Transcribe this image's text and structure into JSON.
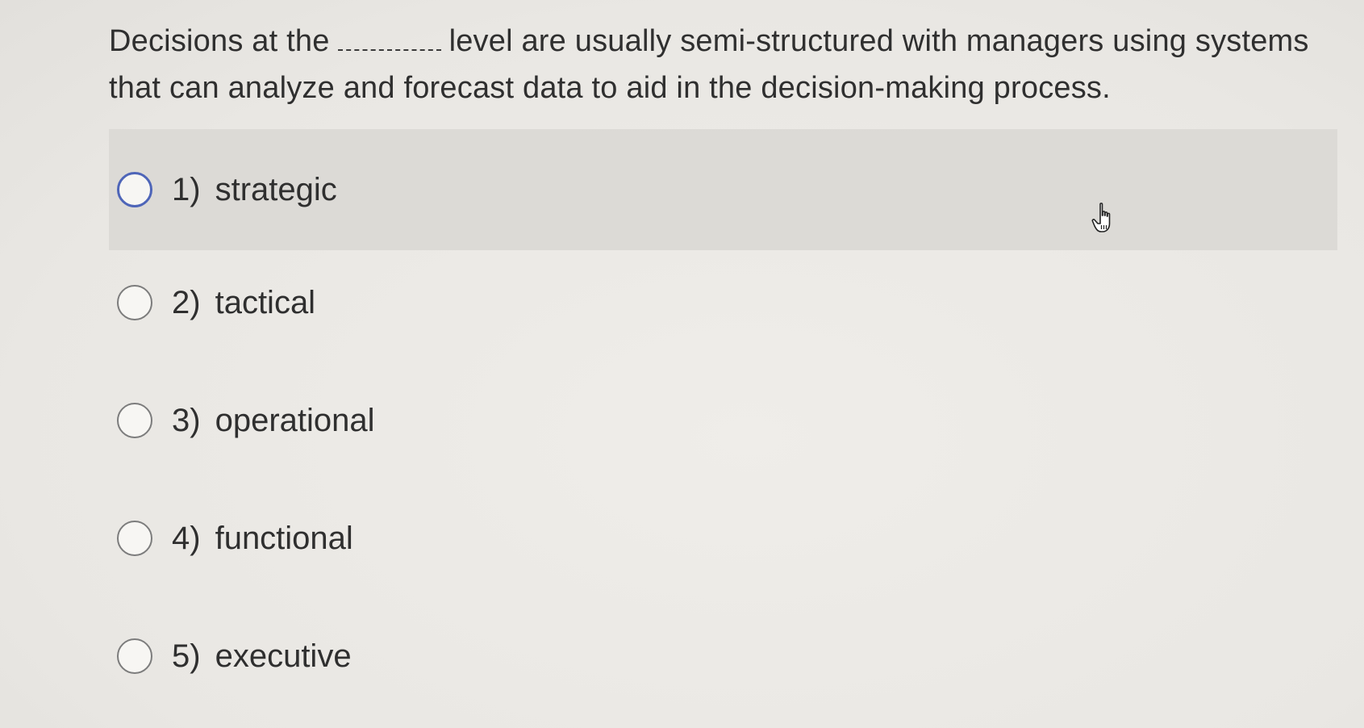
{
  "question": {
    "part1": "Decisions at the",
    "part2": "level are usually semi-structured with managers using systems that can analyze and forecast data to aid in the decision-making process."
  },
  "options": [
    {
      "number": "1)",
      "label": "strategic"
    },
    {
      "number": "2)",
      "label": "tactical"
    },
    {
      "number": "3)",
      "label": "operational"
    },
    {
      "number": "4)",
      "label": "functional"
    },
    {
      "number": "5)",
      "label": "executive"
    }
  ],
  "hovered_option_index": 0,
  "colors": {
    "hover_background": "#dcdad6",
    "radio_hover_border": "#4e65b8",
    "radio_border": "#7c7c7c"
  },
  "icons": {
    "cursor": "hand-pointer-icon"
  }
}
